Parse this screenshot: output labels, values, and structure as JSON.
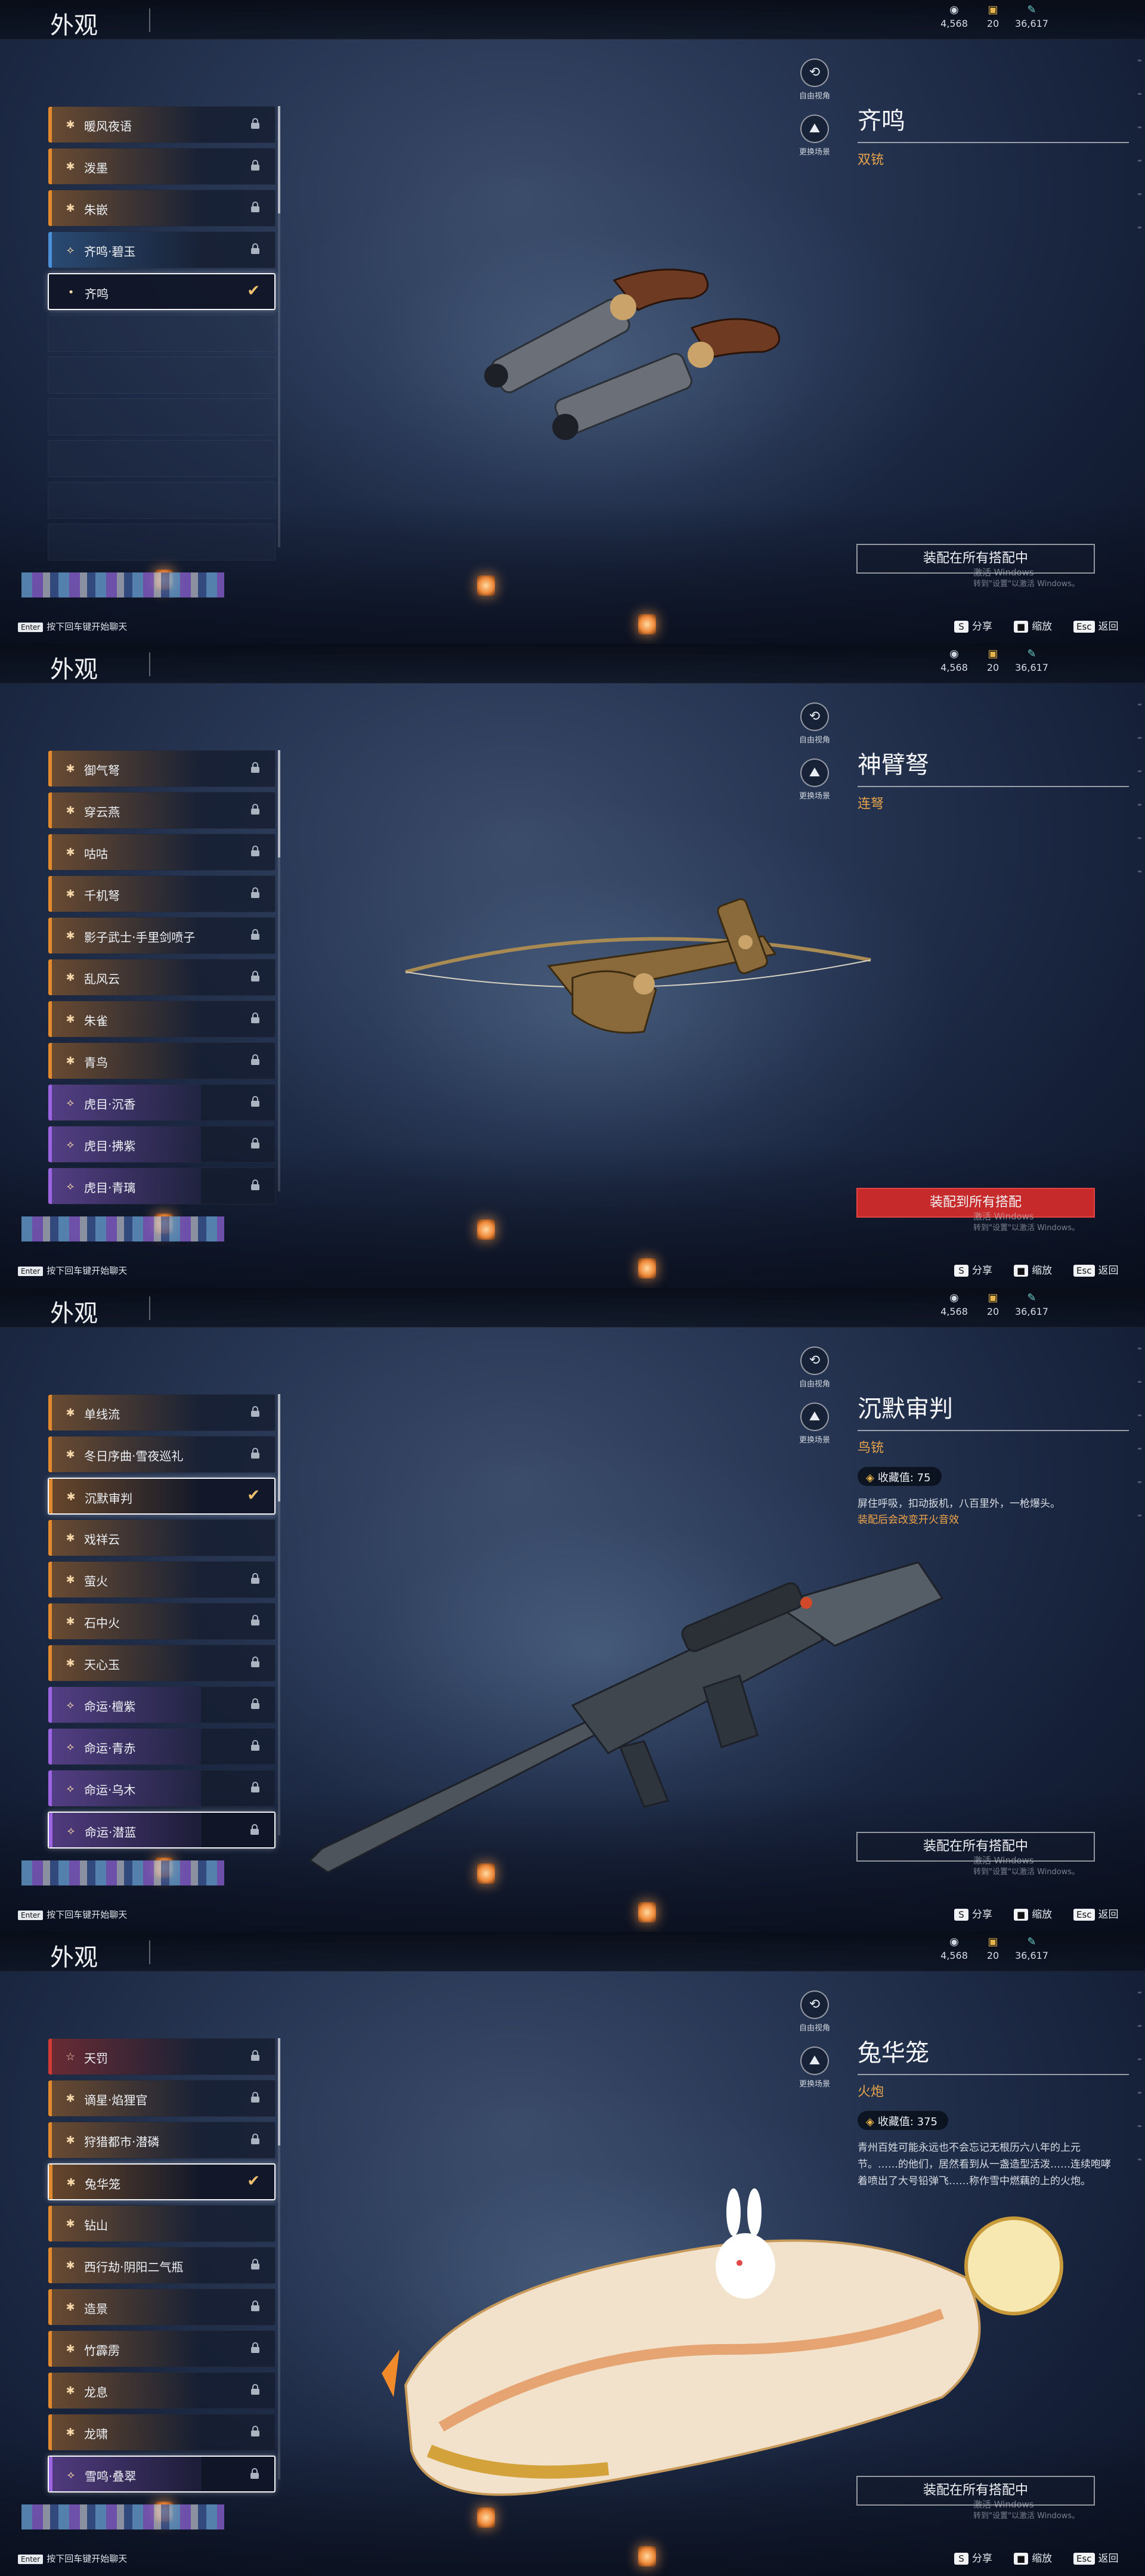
{
  "colors": {
    "accent_orange": "#e8a44a",
    "equip_red": "#c62a2a",
    "quality_orange": "#e0892f",
    "quality_purple": "#9a64e2",
    "quality_blue": "#4a8fd8",
    "quality_red": "#d23a36"
  },
  "panels": [
    {
      "header": {
        "title": "外观",
        "currencies": [
          {
            "icon": "eye-coin-icon",
            "value": "4,568"
          },
          {
            "icon": "box-icon",
            "value": "20"
          },
          {
            "icon": "feather-icon",
            "value": "36,617"
          }
        ]
      },
      "list": [
        {
          "label": "暖风夜语",
          "quality": "orange",
          "icon": "✱",
          "state": "locked"
        },
        {
          "label": "泼墨",
          "quality": "orange",
          "icon": "✱",
          "state": "locked"
        },
        {
          "label": "朱嵌",
          "quality": "orange",
          "icon": "✱",
          "state": "locked"
        },
        {
          "label": "齐鸣·碧玉",
          "quality": "blue",
          "icon": "⟡",
          "state": "locked"
        },
        {
          "label": "齐鸣",
          "quality": "none",
          "icon": "•",
          "state": "selected"
        },
        {
          "label": "",
          "quality": "empty",
          "icon": "",
          "state": "empty"
        },
        {
          "label": "",
          "quality": "empty",
          "icon": "",
          "state": "empty"
        },
        {
          "label": "",
          "quality": "empty",
          "icon": "",
          "state": "empty"
        },
        {
          "label": "",
          "quality": "empty",
          "icon": "",
          "state": "empty"
        },
        {
          "label": "",
          "quality": "empty",
          "icon": "",
          "state": "empty"
        },
        {
          "label": "",
          "quality": "empty",
          "icon": "",
          "state": "empty"
        }
      ],
      "camera": {
        "free_view": "自由视角",
        "change_scene": "更换场景"
      },
      "info": {
        "name": "齐鸣",
        "type": "双铳",
        "collect_label": "",
        "desc": "",
        "desc2": ""
      },
      "equip": {
        "label": "装配在所有搭配中",
        "style": "outline"
      },
      "watermark": {
        "line1": "激活 Windows",
        "line2": "转到\"设置\"以激活 Windows。"
      },
      "weapon": "pistols",
      "chat_hint": {
        "key": "Enter",
        "text": "按下回车键开始聊天"
      },
      "hotkeys": [
        {
          "key": "S",
          "label": "分享"
        },
        {
          "key": "■",
          "label": "缩放"
        },
        {
          "key": "Esc",
          "label": "返回"
        }
      ]
    },
    {
      "header": {
        "title": "外观",
        "currencies": [
          {
            "icon": "eye-coin-icon",
            "value": "4,568"
          },
          {
            "icon": "box-icon",
            "value": "20"
          },
          {
            "icon": "feather-icon",
            "value": "36,617"
          }
        ]
      },
      "list": [
        {
          "label": "御气弩",
          "quality": "orange",
          "icon": "✱",
          "state": "locked"
        },
        {
          "label": "穿云燕",
          "quality": "orange",
          "icon": "✱",
          "state": "locked"
        },
        {
          "label": "咕咕",
          "quality": "orange",
          "icon": "✱",
          "state": "locked"
        },
        {
          "label": "千机弩",
          "quality": "orange",
          "icon": "✱",
          "state": "locked"
        },
        {
          "label": "影子武士·手里剑喷子",
          "quality": "orange",
          "icon": "✱",
          "state": "locked"
        },
        {
          "label": "乱风云",
          "quality": "orange",
          "icon": "✱",
          "state": "locked"
        },
        {
          "label": "朱雀",
          "quality": "orange",
          "icon": "✱",
          "state": "locked"
        },
        {
          "label": "青鸟",
          "quality": "orange",
          "icon": "✱",
          "state": "locked"
        },
        {
          "label": "虎目·沉香",
          "quality": "purple",
          "icon": "⟡",
          "state": "locked"
        },
        {
          "label": "虎目·拂紫",
          "quality": "purple",
          "icon": "⟡",
          "state": "locked"
        },
        {
          "label": "虎目·青璃",
          "quality": "purple",
          "icon": "⟡",
          "state": "locked"
        }
      ],
      "camera": {
        "free_view": "自由视角",
        "change_scene": "更换场景"
      },
      "info": {
        "name": "神臂弩",
        "type": "连弩",
        "collect_label": "",
        "desc": "",
        "desc2": ""
      },
      "equip": {
        "label": "装配到所有搭配",
        "style": "red"
      },
      "watermark": {
        "line1": "激活 Windows",
        "line2": "转到\"设置\"以激活 Windows。"
      },
      "weapon": "crossbow",
      "chat_hint": {
        "key": "Enter",
        "text": "按下回车键开始聊天"
      },
      "hotkeys": [
        {
          "key": "S",
          "label": "分享"
        },
        {
          "key": "■",
          "label": "缩放"
        },
        {
          "key": "Esc",
          "label": "返回"
        }
      ]
    },
    {
      "header": {
        "title": "外观",
        "currencies": [
          {
            "icon": "eye-coin-icon",
            "value": "4,568"
          },
          {
            "icon": "box-icon",
            "value": "20"
          },
          {
            "icon": "feather-icon",
            "value": "36,617"
          }
        ]
      },
      "list": [
        {
          "label": "单线流",
          "quality": "orange",
          "icon": "✱",
          "state": "locked"
        },
        {
          "label": "冬日序曲·雪夜巡礼",
          "quality": "orange",
          "icon": "✱",
          "state": "locked"
        },
        {
          "label": "沉默审判",
          "quality": "orange",
          "icon": "✱",
          "state": "selected"
        },
        {
          "label": "戏祥云",
          "quality": "orange",
          "icon": "✱",
          "state": "none"
        },
        {
          "label": "萤火",
          "quality": "orange",
          "icon": "✱",
          "state": "locked"
        },
        {
          "label": "石中火",
          "quality": "orange",
          "icon": "✱",
          "state": "locked"
        },
        {
          "label": "天心玉",
          "quality": "orange",
          "icon": "✱",
          "state": "locked"
        },
        {
          "label": "命运·檀紫",
          "quality": "purple",
          "icon": "⟡",
          "state": "locked"
        },
        {
          "label": "命运·青赤",
          "quality": "purple",
          "icon": "⟡",
          "state": "locked"
        },
        {
          "label": "命运·乌木",
          "quality": "purple",
          "icon": "⟡",
          "state": "locked"
        },
        {
          "label": "命运·潜蓝",
          "quality": "purple",
          "icon": "⟡",
          "state": "hover"
        }
      ],
      "camera": {
        "free_view": "自由视角",
        "change_scene": "更换场景"
      },
      "info": {
        "name": "沉默审判",
        "type": "鸟铳",
        "collect_label": "收藏值: 75",
        "desc": "屏住呼吸，扣动扳机，八百里外，一枪爆头。",
        "desc2": "装配后会改变开火音效"
      },
      "equip": {
        "label": "装配在所有搭配中",
        "style": "outline"
      },
      "watermark": {
        "line1": "激活 Windows",
        "line2": "转到\"设置\"以激活 Windows。"
      },
      "weapon": "sniper",
      "chat_hint": {
        "key": "Enter",
        "text": "按下回车键开始聊天"
      },
      "hotkeys": [
        {
          "key": "S",
          "label": "分享"
        },
        {
          "key": "■",
          "label": "缩放"
        },
        {
          "key": "Esc",
          "label": "返回"
        }
      ]
    },
    {
      "header": {
        "title": "外观",
        "currencies": [
          {
            "icon": "eye-coin-icon",
            "value": "4,568"
          },
          {
            "icon": "box-icon",
            "value": "20"
          },
          {
            "icon": "feather-icon",
            "value": "36,617"
          }
        ]
      },
      "list": [
        {
          "label": "天罚",
          "quality": "red",
          "icon": "☆",
          "state": "locked"
        },
        {
          "label": "谪星·焰狸官",
          "quality": "orange",
          "icon": "✱",
          "state": "locked"
        },
        {
          "label": "狩猎都市·潜磷",
          "quality": "orange",
          "icon": "✱",
          "state": "locked"
        },
        {
          "label": "兔华笼",
          "quality": "orange",
          "icon": "✱",
          "state": "selected"
        },
        {
          "label": "钻山",
          "quality": "orange",
          "icon": "✱",
          "state": "none"
        },
        {
          "label": "西行劫·阴阳二气瓶",
          "quality": "orange",
          "icon": "✱",
          "state": "locked"
        },
        {
          "label": "造景",
          "quality": "orange",
          "icon": "✱",
          "state": "locked"
        },
        {
          "label": "竹霹雳",
          "quality": "orange",
          "icon": "✱",
          "state": "locked"
        },
        {
          "label": "龙息",
          "quality": "orange",
          "icon": "✱",
          "state": "locked"
        },
        {
          "label": "龙啸",
          "quality": "orange",
          "icon": "✱",
          "state": "locked"
        },
        {
          "label": "雪鸣·叠翠",
          "quality": "purple",
          "icon": "⟡",
          "state": "hover"
        }
      ],
      "camera": {
        "free_view": "自由视角",
        "change_scene": "更换场景"
      },
      "info": {
        "name": "兔华笼",
        "type": "火炮",
        "collect_label": "收藏值: 375",
        "desc": "青州百姓可能永远也不会忘记无根历六八年的上元节。……的他们，居然看到从一盏造型活泼……连续咆哮着喷出了大号铅弹飞……称作雪中燃藕的上的火炮。",
        "desc2": ""
      },
      "equip": {
        "label": "装配在所有搭配中",
        "style": "outline"
      },
      "watermark": {
        "line1": "激活 Windows",
        "line2": "转到\"设置\"以激活 Windows。"
      },
      "weapon": "cannon",
      "chat_hint": {
        "key": "Enter",
        "text": "按下回车键开始聊天"
      },
      "hotkeys": [
        {
          "key": "S",
          "label": "分享"
        },
        {
          "key": "■",
          "label": "缩放"
        },
        {
          "key": "Esc",
          "label": "返回"
        }
      ]
    }
  ]
}
